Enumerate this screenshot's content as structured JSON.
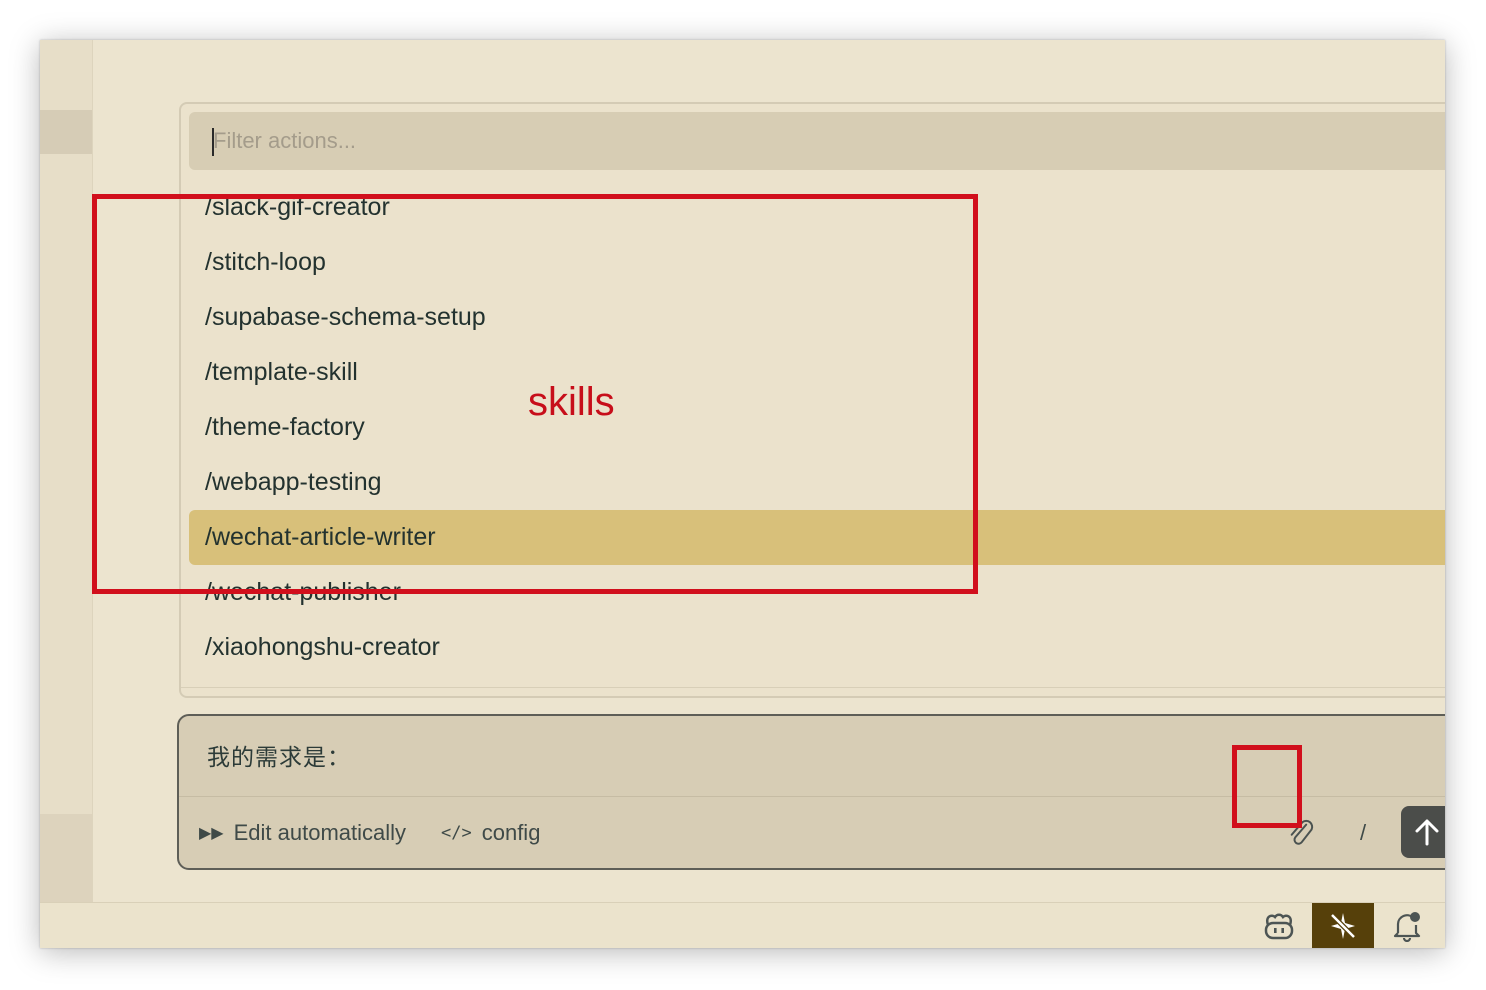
{
  "action_popup": {
    "filter_placeholder": "Filter actions...",
    "items": [
      {
        "label": "/slack-gif-creator"
      },
      {
        "label": "/stitch-loop"
      },
      {
        "label": "/supabase-schema-setup"
      },
      {
        "label": "/template-skill"
      },
      {
        "label": "/theme-factory"
      },
      {
        "label": "/webapp-testing"
      },
      {
        "label": "/wechat-article-writer",
        "selected": true
      },
      {
        "label": "/wechat-publisher"
      },
      {
        "label": "/xiaohongshu-creator"
      }
    ]
  },
  "annotation": {
    "label": "skills",
    "color": "#d10f1c"
  },
  "chat_input": {
    "text": "我的需求是：",
    "edit_mode_label": "Edit automatically",
    "edit_mode_icon": "fast-forward-icon",
    "config_label": "config",
    "config_icon": "code-icon",
    "attach_icon": "paperclip-icon",
    "slash_label": "/",
    "send_icon": "arrow-up-icon"
  },
  "status_bar": {
    "icons": [
      "copilot-icon",
      "sparkle-off-icon",
      "bell-dot-icon"
    ]
  },
  "colors": {
    "selected_item": "#d8c07a",
    "background": "#ece4cf",
    "input_bg": "#d7cdb5",
    "send_button": "#4b4d4a",
    "active_status": "#56400a"
  }
}
